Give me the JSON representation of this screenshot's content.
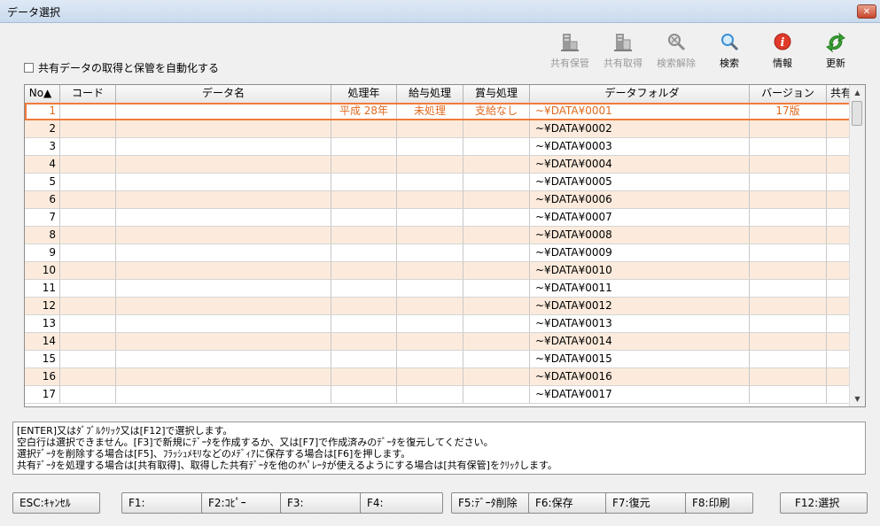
{
  "window": {
    "title": "データ選択",
    "close_label": "✕"
  },
  "auto_option": {
    "label": "共有データの取得と保管を自動化する",
    "checked": false
  },
  "toolbar": [
    {
      "label": "共有保管",
      "icon": "share-store-icon",
      "enabled": false
    },
    {
      "label": "共有取得",
      "icon": "share-fetch-icon",
      "enabled": false
    },
    {
      "label": "検索解除",
      "icon": "search-clear-icon",
      "enabled": false
    },
    {
      "label": "検索",
      "icon": "search-icon",
      "enabled": true
    },
    {
      "label": "情報",
      "icon": "info-icon",
      "enabled": true
    },
    {
      "label": "更新",
      "icon": "refresh-icon",
      "enabled": true
    }
  ],
  "table": {
    "columns": [
      "No▲",
      "コード",
      "データ名",
      "処理年",
      "給与処理",
      "賞与処理",
      "データフォルダ",
      "バージョン",
      "共有"
    ],
    "rows": [
      {
        "no": "1",
        "code": "",
        "name": "",
        "year": "平成 28年",
        "pay": "未処理",
        "bonus": "支給なし",
        "folder": "~¥DATA¥0001",
        "version": "17版",
        "shared": ""
      },
      {
        "no": "2",
        "code": "",
        "name": "",
        "year": "",
        "pay": "",
        "bonus": "",
        "folder": "~¥DATA¥0002",
        "version": "",
        "shared": ""
      },
      {
        "no": "3",
        "code": "",
        "name": "",
        "year": "",
        "pay": "",
        "bonus": "",
        "folder": "~¥DATA¥0003",
        "version": "",
        "shared": ""
      },
      {
        "no": "4",
        "code": "",
        "name": "",
        "year": "",
        "pay": "",
        "bonus": "",
        "folder": "~¥DATA¥0004",
        "version": "",
        "shared": ""
      },
      {
        "no": "5",
        "code": "",
        "name": "",
        "year": "",
        "pay": "",
        "bonus": "",
        "folder": "~¥DATA¥0005",
        "version": "",
        "shared": ""
      },
      {
        "no": "6",
        "code": "",
        "name": "",
        "year": "",
        "pay": "",
        "bonus": "",
        "folder": "~¥DATA¥0006",
        "version": "",
        "shared": ""
      },
      {
        "no": "7",
        "code": "",
        "name": "",
        "year": "",
        "pay": "",
        "bonus": "",
        "folder": "~¥DATA¥0007",
        "version": "",
        "shared": ""
      },
      {
        "no": "8",
        "code": "",
        "name": "",
        "year": "",
        "pay": "",
        "bonus": "",
        "folder": "~¥DATA¥0008",
        "version": "",
        "shared": ""
      },
      {
        "no": "9",
        "code": "",
        "name": "",
        "year": "",
        "pay": "",
        "bonus": "",
        "folder": "~¥DATA¥0009",
        "version": "",
        "shared": ""
      },
      {
        "no": "10",
        "code": "",
        "name": "",
        "year": "",
        "pay": "",
        "bonus": "",
        "folder": "~¥DATA¥0010",
        "version": "",
        "shared": ""
      },
      {
        "no": "11",
        "code": "",
        "name": "",
        "year": "",
        "pay": "",
        "bonus": "",
        "folder": "~¥DATA¥0011",
        "version": "",
        "shared": ""
      },
      {
        "no": "12",
        "code": "",
        "name": "",
        "year": "",
        "pay": "",
        "bonus": "",
        "folder": "~¥DATA¥0012",
        "version": "",
        "shared": ""
      },
      {
        "no": "13",
        "code": "",
        "name": "",
        "year": "",
        "pay": "",
        "bonus": "",
        "folder": "~¥DATA¥0013",
        "version": "",
        "shared": ""
      },
      {
        "no": "14",
        "code": "",
        "name": "",
        "year": "",
        "pay": "",
        "bonus": "",
        "folder": "~¥DATA¥0014",
        "version": "",
        "shared": ""
      },
      {
        "no": "15",
        "code": "",
        "name": "",
        "year": "",
        "pay": "",
        "bonus": "",
        "folder": "~¥DATA¥0015",
        "version": "",
        "shared": ""
      },
      {
        "no": "16",
        "code": "",
        "name": "",
        "year": "",
        "pay": "",
        "bonus": "",
        "folder": "~¥DATA¥0016",
        "version": "",
        "shared": ""
      },
      {
        "no": "17",
        "code": "",
        "name": "",
        "year": "",
        "pay": "",
        "bonus": "",
        "folder": "~¥DATA¥0017",
        "version": "",
        "shared": ""
      }
    ],
    "selected_row": 1
  },
  "help_lines": [
    "[ENTER]又はﾀﾞﾌﾞﾙｸﾘｯｸ又は[F12]で選択します。",
    "空白行は選択できません。[F3]で新規にﾃﾞｰﾀを作成するか、又は[F7]で作成済みのﾃﾞｰﾀを復元してください。",
    "選択ﾃﾞｰﾀを削除する場合は[F5]、ﾌﾗｯｼｭﾒﾓﾘなどのﾒﾃﾞｨｱに保存する場合は[F6]を押します。",
    "共有ﾃﾞｰﾀを処理する場合は[共有取得]、取得した共有ﾃﾞｰﾀを他のｵﾍﾟﾚｰﾀが使えるようにする場合は[共有保管]をｸﾘｯｸします。"
  ],
  "function_keys": [
    {
      "label": "ESC:ｷｬﾝｾﾙ"
    },
    {
      "label": "F1:"
    },
    {
      "label": "F2:ｺﾋﾟｰ"
    },
    {
      "label": "F3:"
    },
    {
      "label": "F4:"
    },
    {
      "label": "F5:ﾃﾞｰﾀ削除"
    },
    {
      "label": "F6:保存"
    },
    {
      "label": "F7:復元"
    },
    {
      "label": "F8:印刷"
    },
    {
      "label": "F12:選択"
    }
  ],
  "colors": {
    "accent": "#f07b3a",
    "alt_row": "#fcebdc",
    "disabled_text": "#9a9a9a"
  }
}
